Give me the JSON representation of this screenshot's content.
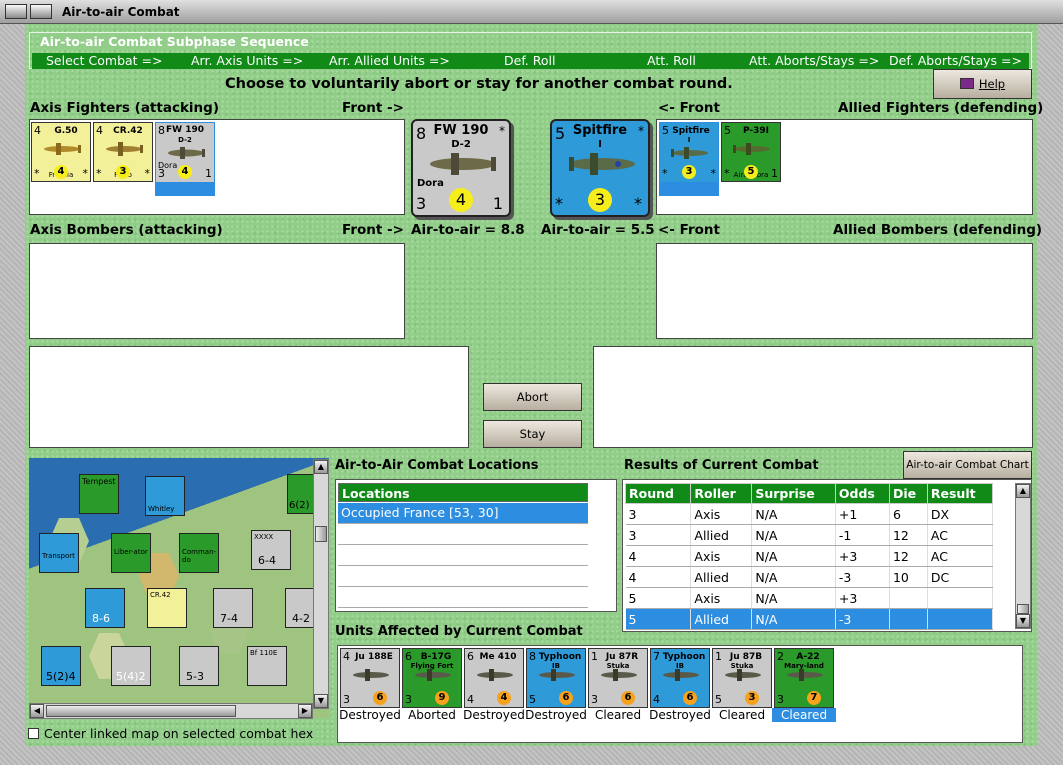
{
  "window": {
    "title": "Air-to-air Combat"
  },
  "sequence": {
    "header": "Air-to-air Combat Subphase Sequence",
    "steps": [
      "Select Combat =>",
      "Arr. Axis Units =>",
      "Arr. Allied Units =>",
      "Def. Roll",
      "Att. Roll",
      "Att. Aborts/Stays =>",
      "Def. Aborts/Stays =>"
    ]
  },
  "instruction": "Choose to voluntarily abort or stay for another combat round.",
  "help_label": "Help",
  "axis_fighters": {
    "label": "Axis Fighters (attacking)",
    "front": "Front ->",
    "units": [
      {
        "name": "G.50",
        "sub": "Freccia",
        "tl": "4",
        "bl": "*",
        "circ": "4",
        "br": "*"
      },
      {
        "name": "CR.42",
        "sub": "Falco",
        "tl": "4",
        "bl": "*",
        "circ": "3",
        "br": "*"
      },
      {
        "name": "FW 190",
        "sub": "D-2",
        "extra": "Dora",
        "tl": "8",
        "bl": "3",
        "circ": "4",
        "br": "1"
      }
    ]
  },
  "allied_fighters": {
    "label": "Allied Fighters (defending)",
    "front": "<- Front",
    "units": [
      {
        "name": "Spitfire",
        "sub": "I",
        "tl": "5",
        "bl": "*",
        "circ": "3",
        "br": "*"
      },
      {
        "name": "P-39I",
        "sub": "AiraCobra",
        "tl": "5",
        "bl": "*",
        "circ": "5",
        "br": "1"
      }
    ]
  },
  "big_axis": {
    "name": "FW 190",
    "sub": "D-2",
    "extra": "Dora",
    "tl": "8",
    "tr": "*",
    "bl": "3",
    "circ": "4",
    "br": "1"
  },
  "big_allied": {
    "name": "Spitfire",
    "sub": "I",
    "tl": "5",
    "tr": "*",
    "bl": "*",
    "circ": "3",
    "br": "*"
  },
  "axis_air_value": "Air-to-air = 8.8",
  "allied_air_value": "Air-to-air = 5.5",
  "axis_bombers": {
    "label": "Axis Bombers (attacking)",
    "front": "Front ->"
  },
  "allied_bombers": {
    "label": "Allied Bombers (defending)",
    "front": "<- Front"
  },
  "abort_label": "Abort",
  "stay_label": "Stay",
  "locations": {
    "title": "Air-to-Air Combat Locations",
    "column": "Locations",
    "rows": [
      "Occupied France [53, 30]"
    ]
  },
  "results": {
    "title": "Results of Current Combat",
    "chart_button": "Air-to-air Combat Chart",
    "columns": [
      "Round",
      "Roller",
      "Surprise",
      "Odds",
      "Die",
      "Result"
    ],
    "rows": [
      [
        "3",
        "Axis",
        "N/A",
        "+1",
        "6",
        "DX"
      ],
      [
        "3",
        "Allied",
        "N/A",
        "-1",
        "12",
        "AC"
      ],
      [
        "4",
        "Axis",
        "N/A",
        "+3",
        "12",
        "AC"
      ],
      [
        "4",
        "Allied",
        "N/A",
        "-3",
        "10",
        "DC"
      ],
      [
        "5",
        "Axis",
        "N/A",
        "+3",
        "",
        ""
      ],
      [
        "5",
        "Allied",
        "N/A",
        "-3",
        "",
        ""
      ]
    ]
  },
  "affected": {
    "title": "Units Affected by Current Combat",
    "units": [
      {
        "name": "Ju 188E",
        "tl": "4",
        "bl": "3",
        "circ": "6",
        "caption": "Destroyed",
        "color": "#c9c9c9"
      },
      {
        "name": "B-17G",
        "sub": "Flying Fort",
        "tl": "6",
        "bl": "3",
        "circ": "9",
        "caption": "Aborted",
        "color": "#2a9a2a"
      },
      {
        "name": "Me 410",
        "tl": "6",
        "bl": "4",
        "circ": "4",
        "caption": "Destroyed",
        "color": "#c9c9c9"
      },
      {
        "name": "Typhoon",
        "sub": "IB",
        "tl": "8",
        "bl": "5",
        "circ": "6",
        "caption": "Destroyed",
        "color": "#2e9ad8"
      },
      {
        "name": "Ju 87R",
        "sub": "Stuka",
        "tl": "1",
        "bl": "3",
        "circ": "6",
        "caption": "Cleared",
        "color": "#c9c9c9"
      },
      {
        "name": "Typhoon",
        "sub": "IB",
        "tl": "7",
        "bl": "4",
        "circ": "6",
        "caption": "Destroyed",
        "color": "#2e9ad8"
      },
      {
        "name": "Ju 87B",
        "sub": "Stuka",
        "tl": "1",
        "bl": "5",
        "circ": "3",
        "caption": "Cleared",
        "color": "#c9c9c9"
      },
      {
        "name": "A-22",
        "sub": "Mary-land",
        "tl": "2",
        "bl": "3",
        "circ": "7",
        "caption": "Cleared",
        "color": "#2a9a2a"
      }
    ]
  },
  "map": {
    "labels": [
      "Tempest",
      "Whitley",
      "Transport",
      "Liber-ator",
      "Comman-do",
      "CR.42",
      "Bf 110E",
      "XXXX",
      "6-4",
      "8-6",
      "7-4",
      "4-2",
      "5(2)4",
      "5(4)2",
      "5-3",
      "6(2)"
    ]
  },
  "center_map_label": "Center linked map on selected combat hex"
}
